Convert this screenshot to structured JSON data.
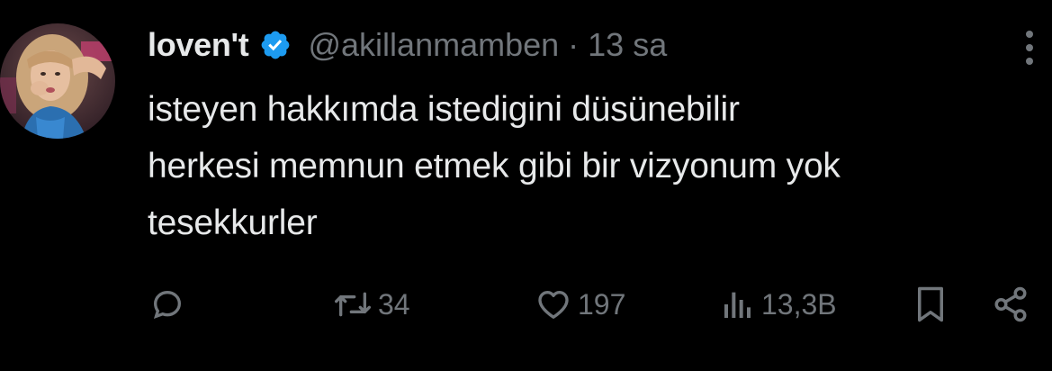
{
  "tweet": {
    "display_name": "loven't",
    "handle": "@akillanmamben",
    "separator": "·",
    "time": "13 sa",
    "text_lines": [
      "isteyen hakkımda istedigini düsünebilir",
      "herkesi memnun etmek gibi bir vizyonum yok",
      "tesekkurler"
    ],
    "verified": true
  },
  "actions": {
    "reply_icon": "reply-icon",
    "retweet_icon": "retweet-icon",
    "retweet_count": "34",
    "like_icon": "heart-icon",
    "like_count": "197",
    "views_icon": "views-chart-icon",
    "views_count": "13,3B",
    "bookmark_icon": "bookmark-icon",
    "share_icon": "share-icon"
  },
  "colors": {
    "background": "#000000",
    "text": "#e7e9ea",
    "muted": "#71767b",
    "verified_blue": "#1d9bf0"
  }
}
